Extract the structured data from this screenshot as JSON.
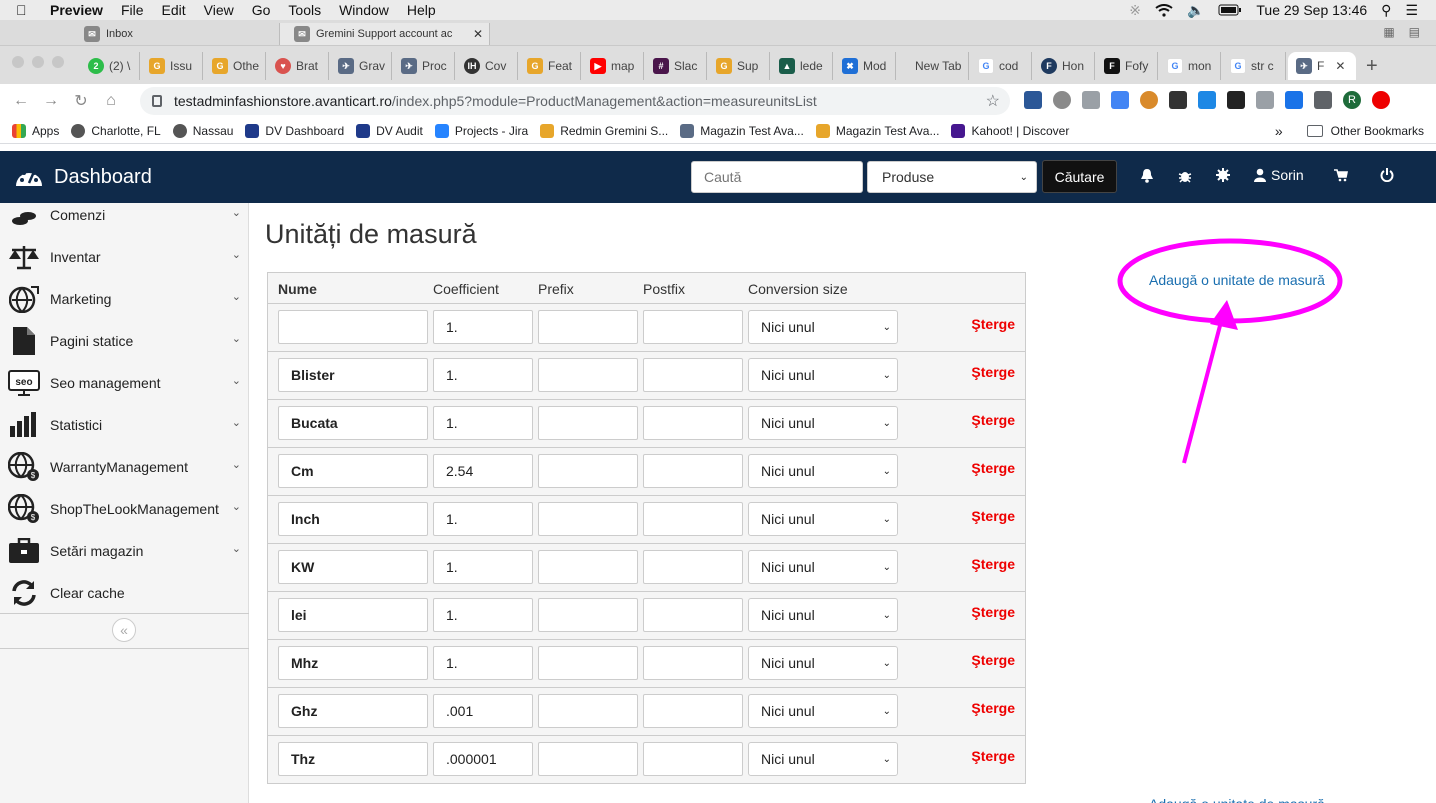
{
  "mac_menubar": {
    "app": "Preview",
    "menus": [
      "File",
      "Edit",
      "View",
      "Go",
      "Tools",
      "Window",
      "Help"
    ],
    "datetime": "Tue 29 Sep  13:46"
  },
  "back_window": {
    "tab1": "Inbox",
    "tab2": "Gremini Support account ac"
  },
  "browser": {
    "tabs": [
      "(2) \\",
      "Issu",
      "Othe",
      "Brat",
      "Grav",
      "Proc",
      "Cov",
      "Feat",
      "map",
      "Slac",
      "Sup",
      "lede",
      "Mod",
      "New Tab",
      "cod",
      "Hon",
      "Fofy",
      "mon",
      "str c",
      "F"
    ],
    "url_host": "testadminfashionstore.avanticart.ro",
    "url_path": "/index.php5?module=ProductManagement&action=measureunitsList",
    "profile_initial": "R",
    "bookmarks": [
      "Apps",
      "Charlotte, FL",
      "Nassau",
      "DV Dashboard",
      "DV Audit",
      "Projects - Jira",
      "Redmin Gremini S...",
      "Magazin Test Ava...",
      "Magazin Test Ava...",
      "Kahoot! | Discover"
    ],
    "bookmarks_more": "»",
    "other_bookmarks": "Other Bookmarks"
  },
  "topnav": {
    "brand": "Dashboard",
    "search_placeholder": "Caută",
    "category_selected": "Produse",
    "search_button": "Căutare",
    "user": "Sorin"
  },
  "sidebar": {
    "items": [
      {
        "label": "Comenzi",
        "icon": "coins-icon"
      },
      {
        "label": "Inventar",
        "icon": "scale-icon"
      },
      {
        "label": "Marketing",
        "icon": "globe-icon"
      },
      {
        "label": "Pagini statice",
        "icon": "file-icon"
      },
      {
        "label": "Seo management",
        "icon": "seo-icon"
      },
      {
        "label": "Statistici",
        "icon": "bar-chart-icon"
      },
      {
        "label": "WarrantyManagement",
        "icon": "globe-dollar-icon"
      },
      {
        "label": "ShopTheLookManagement",
        "icon": "globe-dollar-icon"
      },
      {
        "label": "Setări magazin",
        "icon": "briefcase-icon"
      },
      {
        "label": "Clear cache",
        "icon": "refresh-icon"
      }
    ]
  },
  "main": {
    "title": "Unități de masură",
    "add_link": "Adaugă o unitate de masură",
    "columns": [
      "Nume",
      "Coefficient",
      "Prefix",
      "Postfix",
      "Conversion size"
    ],
    "delete_label": "Şterge",
    "rows": [
      {
        "name": "",
        "coef": "1.",
        "prefix": "",
        "postfix": "",
        "conversion": "Nici unul"
      },
      {
        "name": "Blister",
        "coef": "1.",
        "prefix": "",
        "postfix": "",
        "conversion": "Nici unul"
      },
      {
        "name": "Bucata",
        "coef": "1.",
        "prefix": "",
        "postfix": "",
        "conversion": "Nici unul"
      },
      {
        "name": "Cm",
        "coef": "2.54",
        "prefix": "",
        "postfix": "",
        "conversion": "Nici unul"
      },
      {
        "name": "Inch",
        "coef": "1.",
        "prefix": "",
        "postfix": "",
        "conversion": "Nici unul"
      },
      {
        "name": "KW",
        "coef": "1.",
        "prefix": "",
        "postfix": "",
        "conversion": "Nici unul"
      },
      {
        "name": "lei",
        "coef": "1.",
        "prefix": "",
        "postfix": "",
        "conversion": "Nici unul"
      },
      {
        "name": "Mhz",
        "coef": "1.",
        "prefix": "",
        "postfix": "",
        "conversion": "Nici unul"
      },
      {
        "name": "Ghz",
        "coef": ".001",
        "prefix": "",
        "postfix": "",
        "conversion": "Nici unul"
      },
      {
        "name": "Thz",
        "coef": ".000001",
        "prefix": "",
        "postfix": "",
        "conversion": "Nici unul"
      }
    ]
  },
  "colors": {
    "navbar": "#0f2a4a",
    "link": "#1a6fb0",
    "delete": "#e00000",
    "annotation": "#ff00ff"
  }
}
